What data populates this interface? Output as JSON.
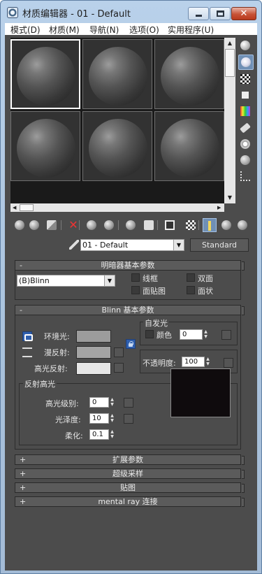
{
  "window": {
    "title": "材质编辑器 - 01 - Default",
    "buttons": {
      "minimize": "minimize-icon",
      "maximize": "maximize-icon",
      "close": "close-icon"
    }
  },
  "menu": [
    "模式(D)",
    "材质(M)",
    "导航(N)",
    "选项(O)",
    "实用程序(U)"
  ],
  "slots": {
    "count": 6,
    "active_index": 0
  },
  "side_tools": [
    "sample-type-sphere-icon",
    "backlight-icon",
    "checker-background-icon",
    "sample-uv-tiling-icon",
    "video-color-check-icon",
    "make-preview-icon",
    "options-icon",
    "select-by-material-icon",
    "material-map-navigator-icon"
  ],
  "h_tools": [
    "get-material-icon",
    "put-to-scene-icon",
    "assign-to-selection-icon",
    "reset-map-icon",
    "copy-material-icon",
    "make-unique-icon",
    "put-to-library-icon",
    "material-id-channel-icon",
    "show-shaded-in-viewport-icon",
    "show-end-result-icon",
    "go-to-parent-icon",
    "go-forward-to-sibling-icon"
  ],
  "toolbar": {
    "material_name": "01 - Default",
    "material_type": "Standard"
  },
  "shader_basic": {
    "header": "明暗器基本参数",
    "shader": "(B)Blinn",
    "options": [
      "线框",
      "双面",
      "面贴图",
      "面状"
    ]
  },
  "blinn_basic": {
    "header": "Blinn 基本参数",
    "ambient_label": "环境光:",
    "diffuse_label": "漫反射:",
    "specular_label": "高光反射:",
    "self_illum_group": "自发光",
    "color_label": "颜色",
    "color_value": "0",
    "opacity_label": "不透明度:",
    "opacity_value": "100",
    "spec_group": "反射高光",
    "spec_level_label": "高光级别:",
    "spec_level_value": "0",
    "glossiness_label": "光泽度:",
    "glossiness_value": "10",
    "soften_label": "柔化:",
    "soften_value": "0.1",
    "colors": {
      "ambient": "#9c9c9c",
      "diffuse": "#a4a4a4",
      "specular": "#e6e6e6"
    }
  },
  "rollouts": [
    "扩展参数",
    "超级采样",
    "贴图",
    "mental ray 连接"
  ],
  "signs": {
    "open": "-",
    "closed": "+"
  }
}
